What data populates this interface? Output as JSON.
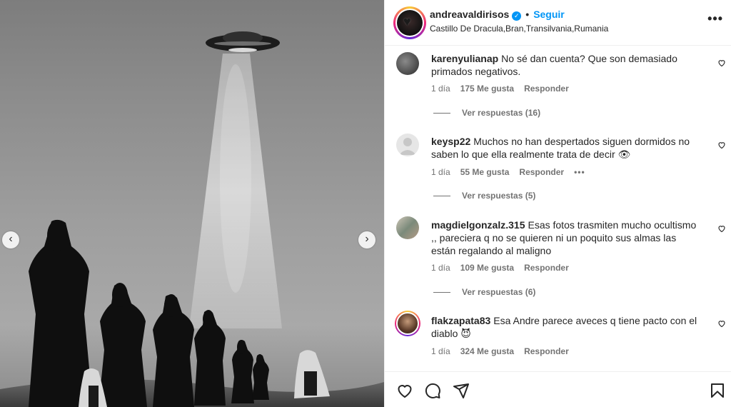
{
  "post": {
    "username": "andreavaldirisos",
    "follow_label": "Seguir",
    "location": "Castillo De Dracula,Bran,Transilvania,Rumania",
    "verified": true
  },
  "media": {
    "prev_arrow": "‹",
    "next_arrow": "›"
  },
  "comments": [
    {
      "username": "karenyulianap",
      "text": "No sé dan cuenta? Que son demasiado primados negativos.",
      "time": "1 día",
      "likes": "175 Me gusta",
      "reply_label": "Responder",
      "replies_label": "Ver respuestas (16)"
    },
    {
      "username": "keysp22",
      "text": "Muchos no han despertados siguen dormidos no saben lo que ella realmente trata de decir 👁",
      "time": "1 día",
      "likes": "55 Me gusta",
      "reply_label": "Responder",
      "options_label": "•••",
      "replies_label": "Ver respuestas (5)"
    },
    {
      "username": "magdielgonzalz.315",
      "text": "Esas fotos trasmiten mucho ocultismo ,, pareciera q no se quieren ni un poquito sus almas las están regalando al maligno",
      "time": "1 día",
      "likes": "109 Me gusta",
      "reply_label": "Responder",
      "replies_label": "Ver respuestas (6)"
    },
    {
      "username": "flakzapata83",
      "text": "Esa Andre parece aveces q tiene pacto con el diablo 😈",
      "time": "1 día",
      "likes": "324 Me gusta",
      "reply_label": "Responder"
    }
  ],
  "colors": {
    "accent": "#0095f6",
    "text": "#262626",
    "muted": "#737373",
    "border": "#efefef"
  },
  "icons": {
    "like": "heart-icon",
    "comment": "comment-bubble-icon",
    "share": "paper-plane-icon",
    "save": "bookmark-icon",
    "more": "more-options-icon"
  }
}
